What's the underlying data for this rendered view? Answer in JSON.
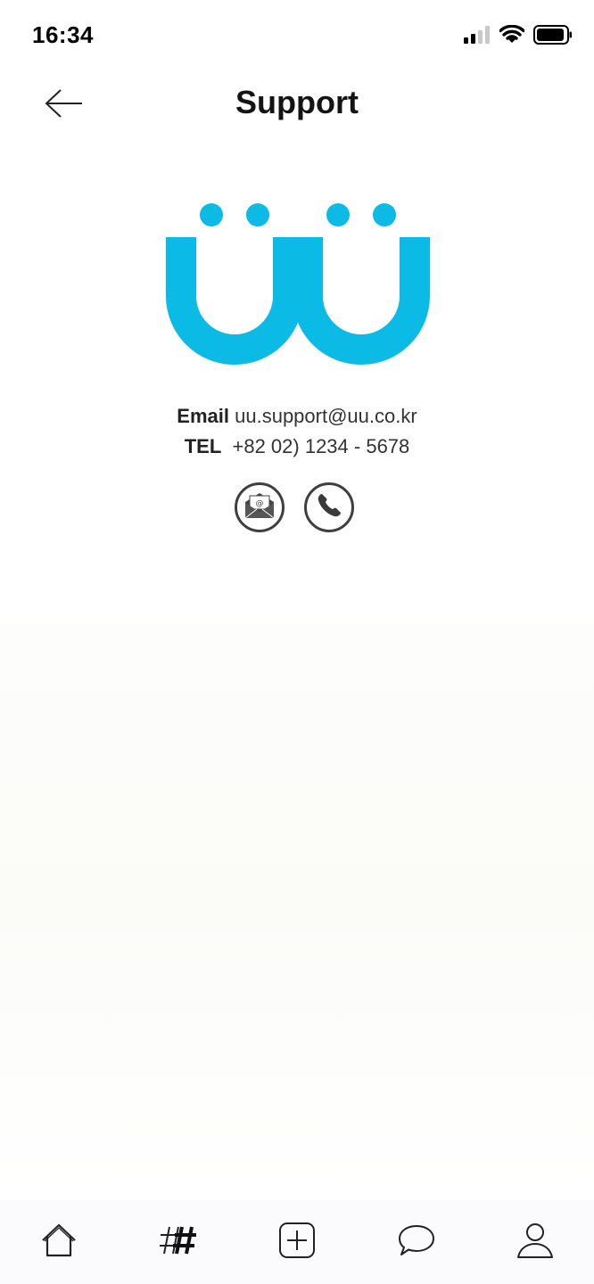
{
  "status_bar": {
    "time": "16:34",
    "icons": [
      "signal-icon",
      "wifi-icon",
      "battery-icon"
    ]
  },
  "header": {
    "title": "Support",
    "back_icon": "arrow-left-icon"
  },
  "logo": {
    "text": "ÜÜ",
    "color": "#0bbbe6"
  },
  "contact": {
    "email_label": "Email",
    "email_value": "uu.support@uu.co.kr",
    "tel_label": "TEL",
    "tel_value": "+82 02) 1234 - 5678",
    "actions": [
      "email-icon",
      "phone-icon"
    ]
  },
  "bottom_nav": {
    "items": [
      "home-icon",
      "hashtag-icon",
      "add-icon",
      "chat-icon",
      "profile-icon"
    ]
  }
}
